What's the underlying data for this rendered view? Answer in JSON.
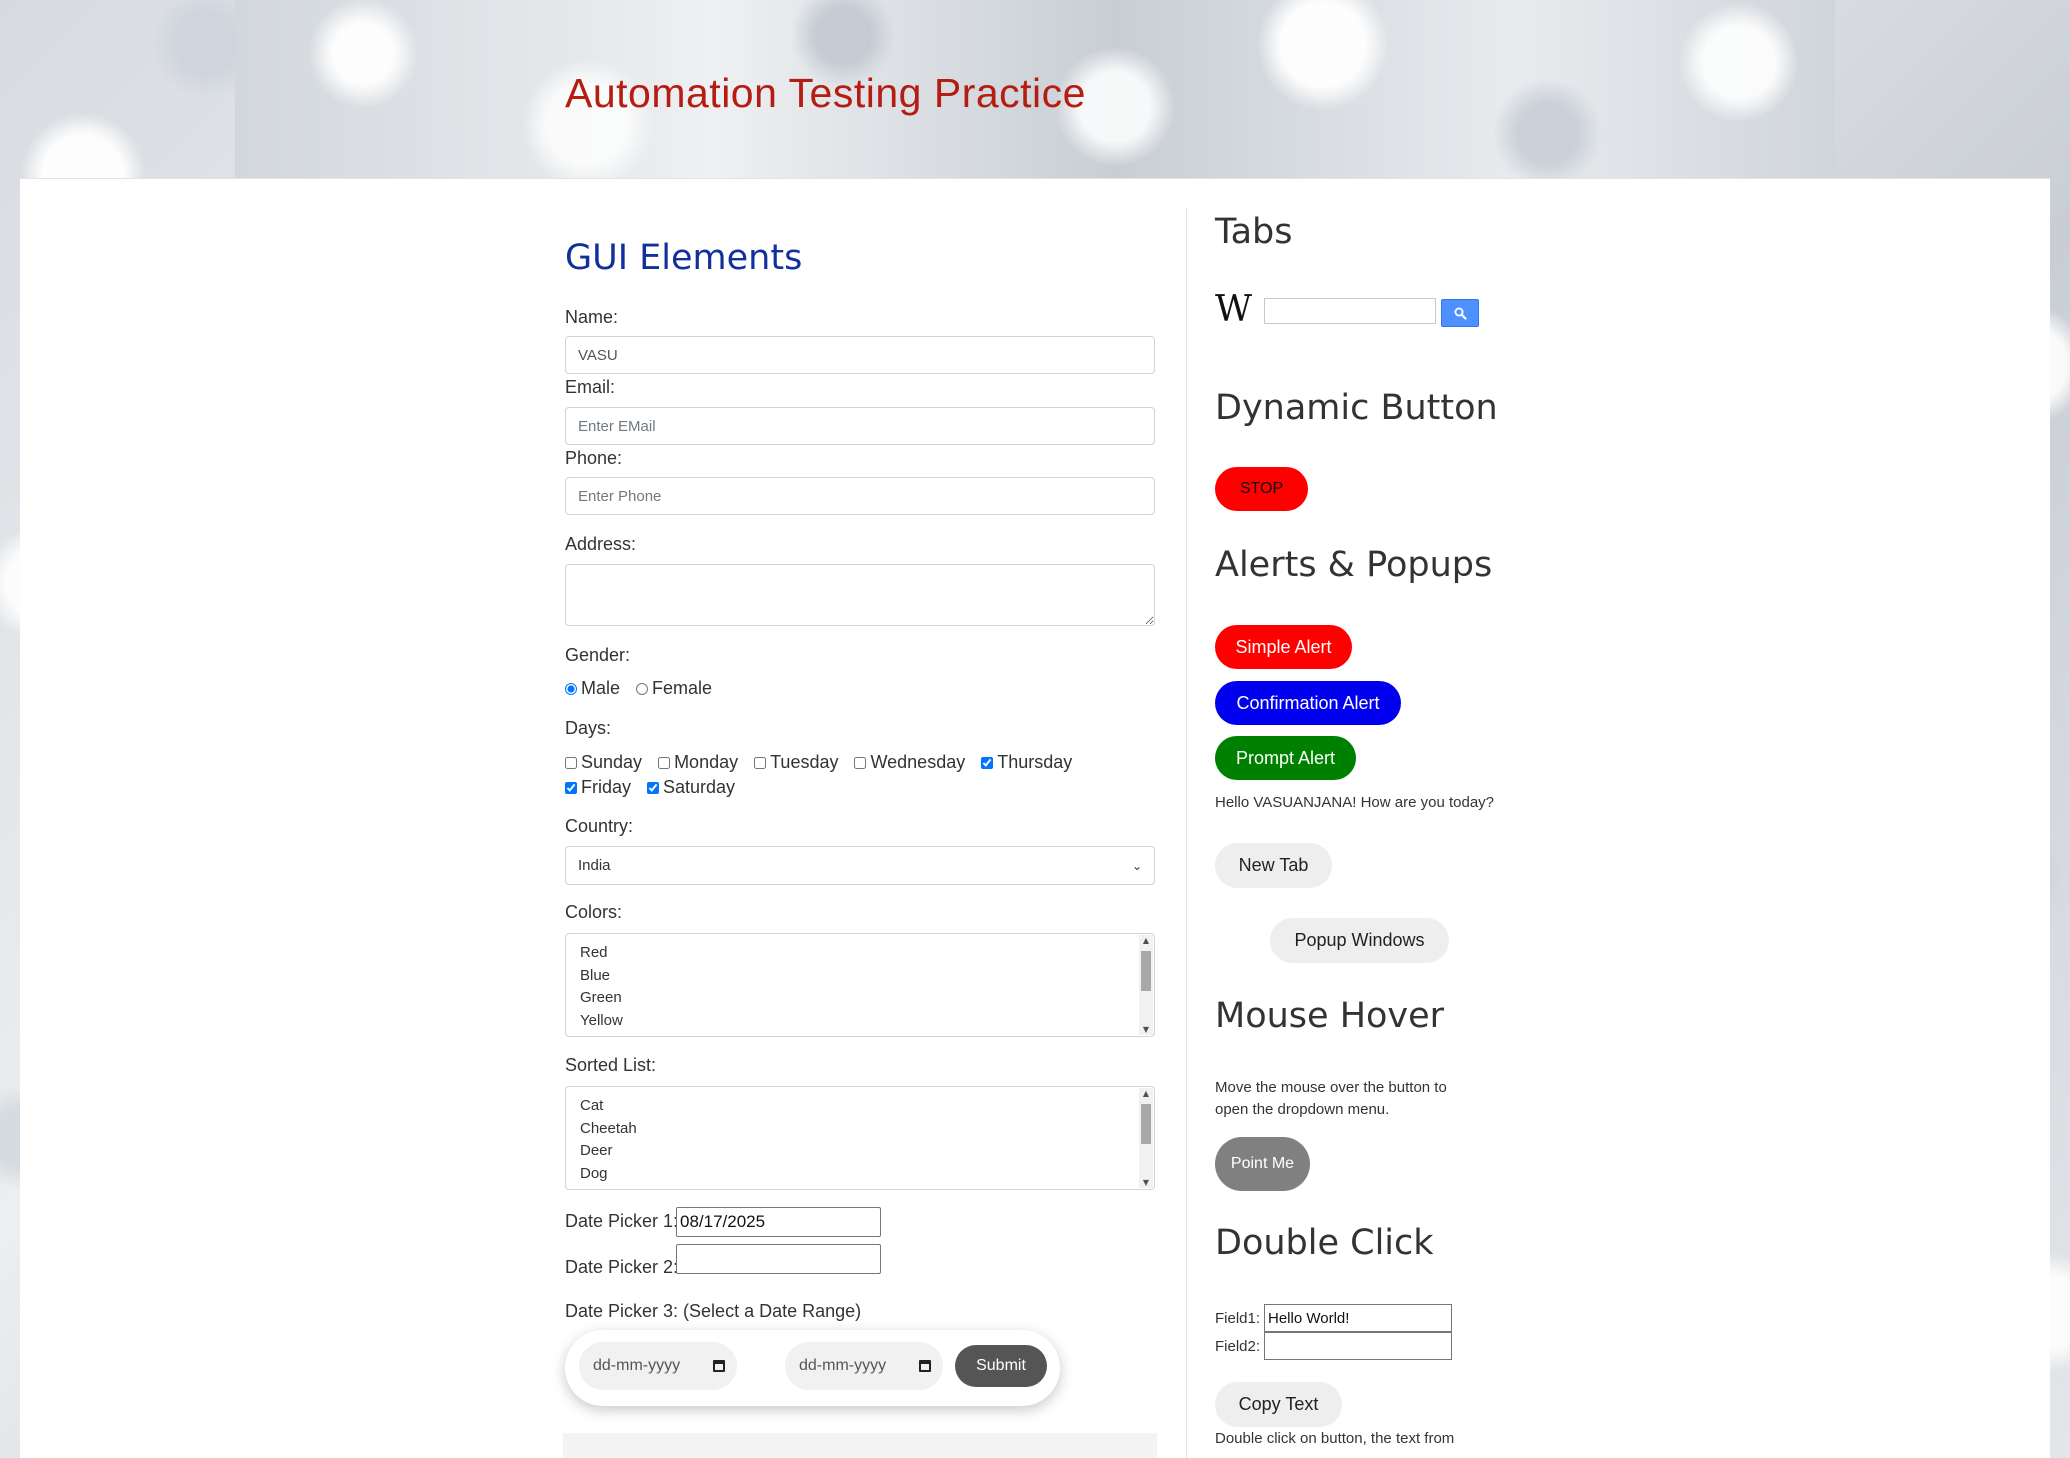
{
  "header": {
    "title": "Automation Testing Practice"
  },
  "gui": {
    "heading": "GUI Elements",
    "name": {
      "label": "Name:",
      "value": "VASU"
    },
    "email": {
      "label": "Email:",
      "placeholder": "Enter EMail"
    },
    "phone": {
      "label": "Phone:",
      "placeholder": "Enter Phone"
    },
    "address": {
      "label": "Address:"
    },
    "gender": {
      "label": "Gender:",
      "options": [
        "Male",
        "Female"
      ],
      "selected": "Male"
    },
    "days": {
      "label": "Days:",
      "options": [
        "Sunday",
        "Monday",
        "Tuesday",
        "Wednesday",
        "Thursday",
        "Friday",
        "Saturday"
      ],
      "checked": [
        "Thursday",
        "Friday",
        "Saturday"
      ]
    },
    "country": {
      "label": "Country:",
      "selected": "India"
    },
    "colors": {
      "label": "Colors:",
      "items": [
        "Red",
        "Blue",
        "Green",
        "Yellow"
      ]
    },
    "sorted_list": {
      "label": "Sorted List:",
      "items": [
        "Cat",
        "Cheetah",
        "Deer",
        "Dog"
      ]
    },
    "date_picker_1": {
      "label": "Date Picker 1:",
      "value": "08/17/2025"
    },
    "date_picker_2": {
      "label": "Date Picker 2:",
      "value": ""
    },
    "date_picker_3": {
      "label": "Date Picker 3: (Select a Date Range)",
      "start_placeholder": "dd-mm-yyyy",
      "end_placeholder": "dd-mm-yyyy",
      "submit_label": "Submit"
    }
  },
  "sidebar": {
    "tabs": {
      "heading": "Tabs",
      "wiki_logo": "W",
      "search_icon": "search-icon"
    },
    "dynamic_button": {
      "heading": "Dynamic Button",
      "label": "STOP"
    },
    "alerts": {
      "heading": "Alerts & Popups",
      "simple": "Simple Alert",
      "confirmation": "Confirmation Alert",
      "prompt": "Prompt Alert",
      "message": "Hello VASUANJANA! How are you today?",
      "new_tab": "New Tab",
      "popup_windows": "Popup Windows"
    },
    "mouse_hover": {
      "heading": "Mouse Hover",
      "description_line1": "Move the mouse over the button to",
      "description_line2": "open the dropdown menu.",
      "button": "Point Me"
    },
    "double_click": {
      "heading": "Double Click",
      "field1_label": "Field1:",
      "field1_value": "Hello World!",
      "field2_label": "Field2:",
      "field2_value": "",
      "copy_button": "Copy Text",
      "description": "Double click on button, the text from"
    }
  },
  "colors": {
    "title_red": "#b51d12",
    "heading_blue": "#12309c",
    "red": "#ff0000",
    "blue": "#0000ee",
    "green": "#008000",
    "gray_button": "#eeeeee",
    "hover_gray": "#808080"
  }
}
